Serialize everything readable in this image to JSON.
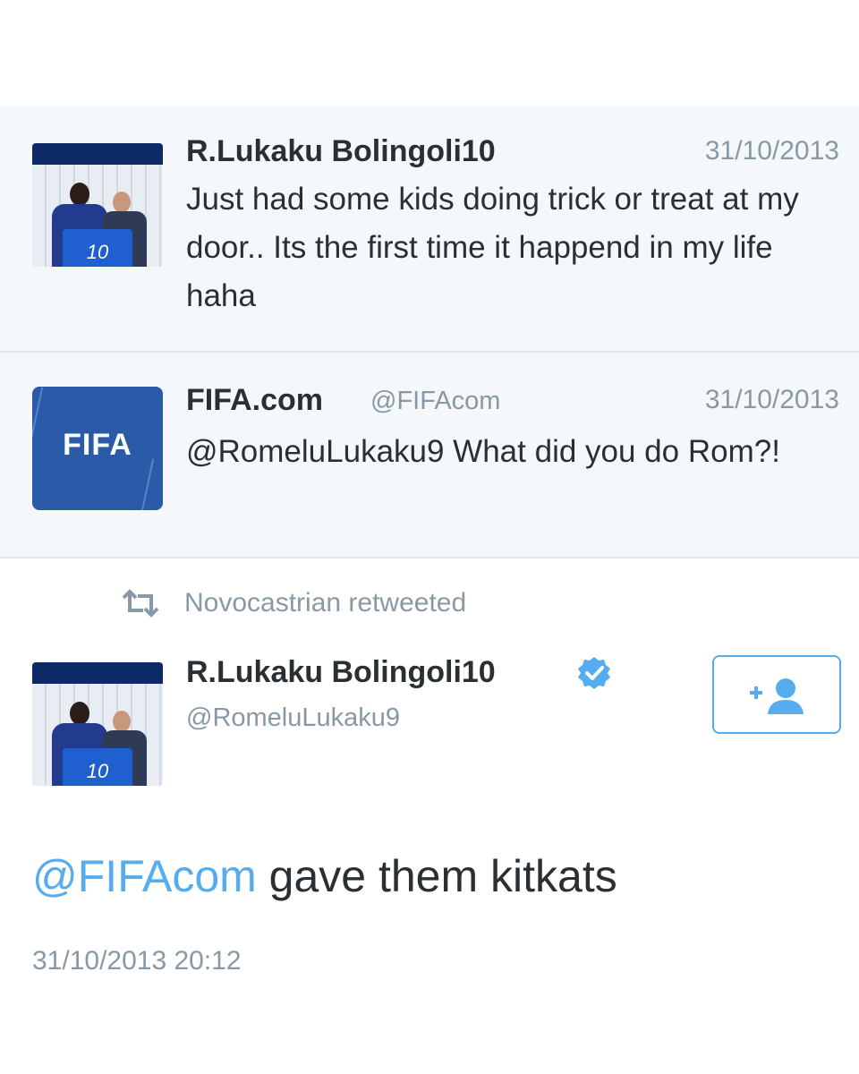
{
  "tweets": [
    {
      "name": "R.Lukaku Bolingoli10",
      "date": "31/10/2013",
      "text": "Just had some kids doing trick or treat at my door.. Its the first time it happend in my life haha",
      "avatar": {
        "jersey_number": "10"
      }
    },
    {
      "name": "FIFA.com",
      "handle": "@FIFAcom",
      "date": "31/10/2013",
      "text": "@RomeluLukaku9 What did you do Rom?!",
      "avatar": {
        "logo_text": "FIFA"
      }
    }
  ],
  "retweet": {
    "label": "Novocastrian retweeted",
    "icon": "retweet-icon"
  },
  "main_tweet": {
    "name": "R.Lukaku Bolingoli10",
    "handle": "@RomeluLukaku9",
    "verified_icon": "verified-badge-icon",
    "follow_icon": "add-user-icon",
    "mention": "@FIFAcom",
    "text": " gave them kitkats",
    "timestamp": "31/10/2013 20:12",
    "avatar": {
      "jersey_number": "10"
    }
  },
  "colors": {
    "accent": "#55acee",
    "muted": "#8899a6",
    "text": "#292f33",
    "row_background": "#f5f8fa",
    "fifa_blue": "#2b5aa8"
  }
}
